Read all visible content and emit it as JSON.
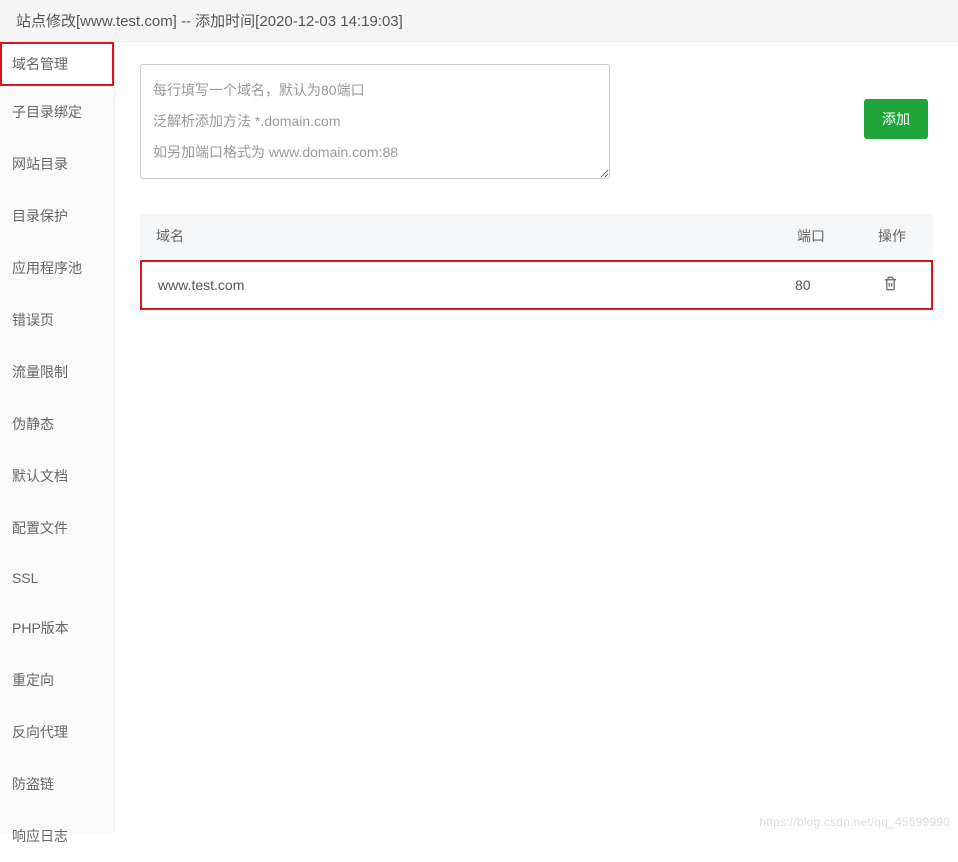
{
  "header": {
    "title": "站点修改[www.test.com] -- 添加时间[2020-12-03 14:19:03]"
  },
  "sidebar": {
    "items": [
      {
        "label": "域名管理",
        "id": "domain-mgmt",
        "active": true
      },
      {
        "label": "子目录绑定",
        "id": "subdir-bind",
        "active": false
      },
      {
        "label": "网站目录",
        "id": "site-dir",
        "active": false
      },
      {
        "label": "目录保护",
        "id": "dir-protect",
        "active": false
      },
      {
        "label": "应用程序池",
        "id": "app-pool",
        "active": false
      },
      {
        "label": "错误页",
        "id": "error-page",
        "active": false
      },
      {
        "label": "流量限制",
        "id": "rate-limit",
        "active": false
      },
      {
        "label": "伪静态",
        "id": "rewrite",
        "active": false
      },
      {
        "label": "默认文档",
        "id": "default-doc",
        "active": false
      },
      {
        "label": "配置文件",
        "id": "config-file",
        "active": false
      },
      {
        "label": "SSL",
        "id": "ssl",
        "active": false
      },
      {
        "label": "PHP版本",
        "id": "php-version",
        "active": false
      },
      {
        "label": "重定向",
        "id": "redirect",
        "active": false
      },
      {
        "label": "反向代理",
        "id": "reverse-proxy",
        "active": false
      },
      {
        "label": "防盗链",
        "id": "hotlink",
        "active": false
      },
      {
        "label": "响应日志",
        "id": "response-log",
        "active": false
      }
    ]
  },
  "main": {
    "input_placeholder": "每行填写一个域名，默认为80端口\n泛解析添加方法 *.domain.com\n如另加端口格式为 www.domain.com:88",
    "add_button": "添加",
    "table": {
      "headers": {
        "domain": "域名",
        "port": "端口",
        "action": "操作"
      },
      "rows": [
        {
          "domain": "www.test.com",
          "port": "80"
        }
      ]
    }
  },
  "watermark": "https://blog.csdn.net/qq_45699990"
}
